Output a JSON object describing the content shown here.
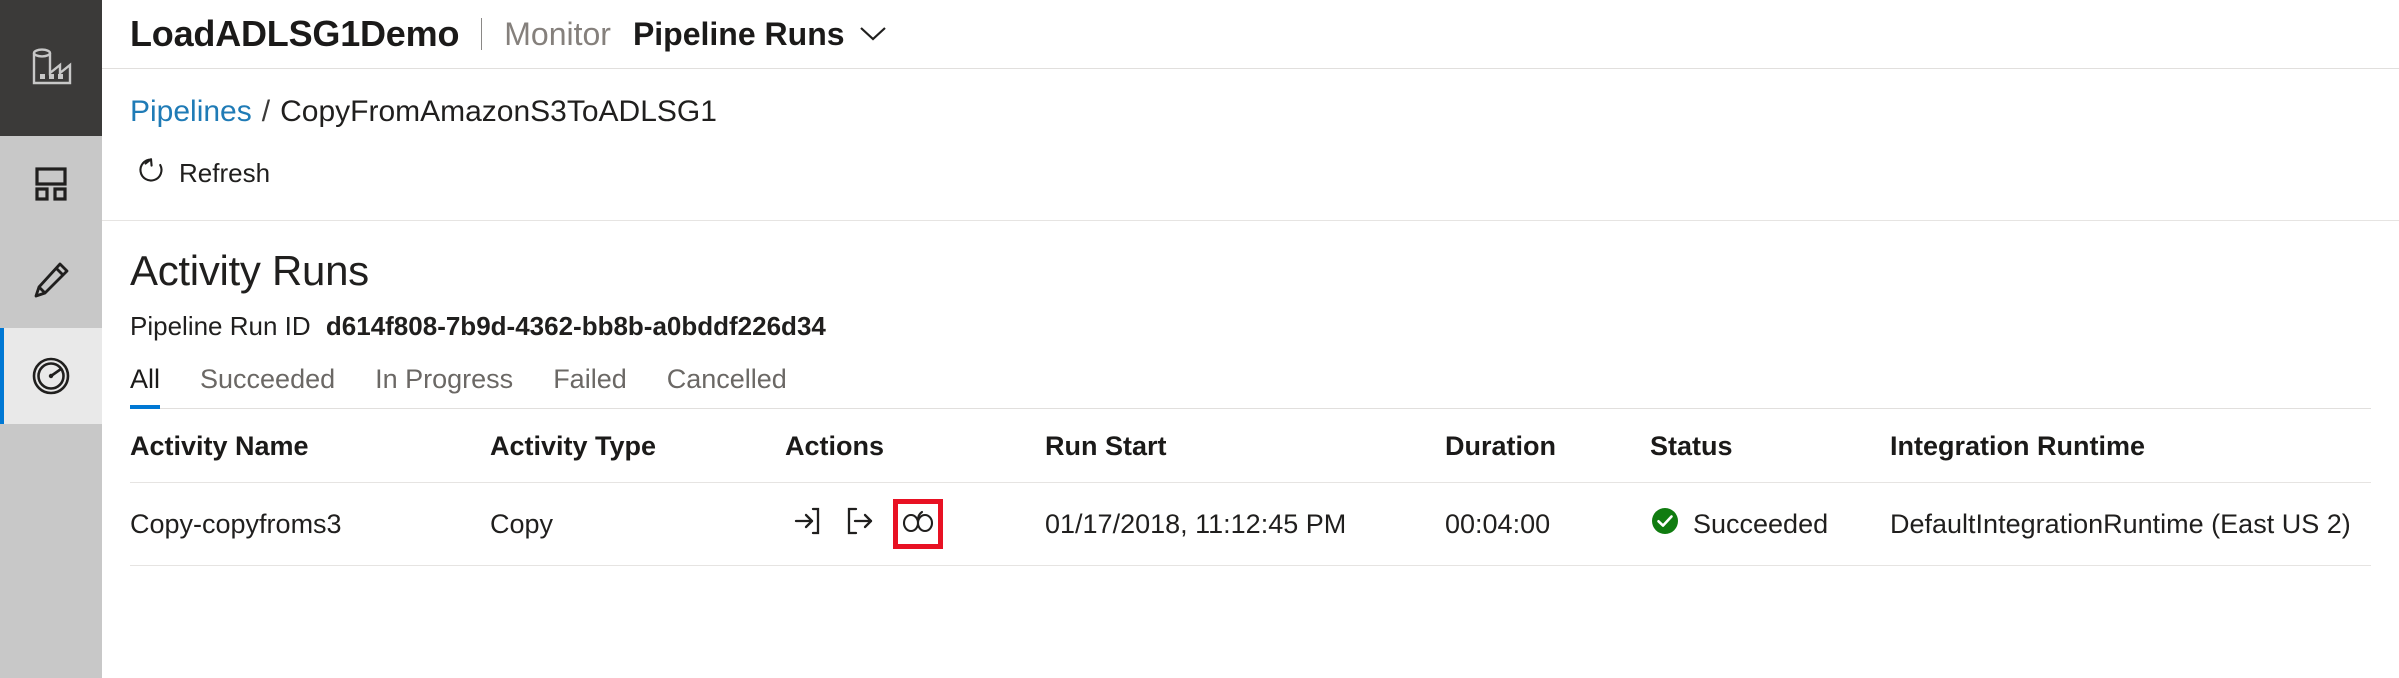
{
  "header": {
    "factory_name": "LoadADLSG1Demo",
    "section": "Monitor",
    "page": "Pipeline Runs",
    "chevron_icon": "chevron-down-icon",
    "factory_icon": "factory-icon"
  },
  "rail": {
    "items": [
      {
        "icon": "factory-icon",
        "name": "factory-logo",
        "selected": false
      },
      {
        "icon": "home-icon",
        "name": "home",
        "selected": false
      },
      {
        "icon": "pencil-icon",
        "name": "author",
        "selected": false
      },
      {
        "icon": "gauge-icon",
        "name": "monitor",
        "selected": true
      }
    ]
  },
  "breadcrumb": {
    "root": "Pipelines",
    "separator": "/",
    "current": "CopyFromAmazonS3ToADLSG1"
  },
  "toolbar": {
    "refresh_label": "Refresh",
    "refresh_icon": "refresh-icon"
  },
  "activity_runs": {
    "title": "Activity Runs",
    "run_id_label": "Pipeline Run ID",
    "run_id_value": "d614f808-7b9d-4362-bb8b-a0bddf226d34",
    "tabs": [
      {
        "label": "All",
        "active": true
      },
      {
        "label": "Succeeded",
        "active": false
      },
      {
        "label": "In Progress",
        "active": false
      },
      {
        "label": "Failed",
        "active": false
      },
      {
        "label": "Cancelled",
        "active": false
      }
    ],
    "columns": [
      "Activity Name",
      "Activity Type",
      "Actions",
      "Run Start",
      "Duration",
      "Status",
      "Integration Runtime"
    ],
    "rows": [
      {
        "activity_name": "Copy-copyfroms3",
        "activity_type": "Copy",
        "actions": [
          {
            "icon": "input-arrow-icon",
            "name": "view-input",
            "highlighted": false
          },
          {
            "icon": "output-arrow-icon",
            "name": "view-output",
            "highlighted": false
          },
          {
            "icon": "glasses-details-icon",
            "name": "view-details",
            "highlighted": true
          }
        ],
        "run_start": "01/17/2018, 11:12:45 PM",
        "duration": "00:04:00",
        "status": "Succeeded",
        "status_icon": "success-check-icon",
        "integration_runtime": "DefaultIntegrationRuntime (East US 2)"
      }
    ]
  },
  "colors": {
    "accent": "#0078d4",
    "link": "#1f7bb6",
    "success": "#107c10",
    "highlight": "#e81123",
    "rail_bg": "#c8c8c8",
    "logo_bg": "#3b3a39"
  }
}
